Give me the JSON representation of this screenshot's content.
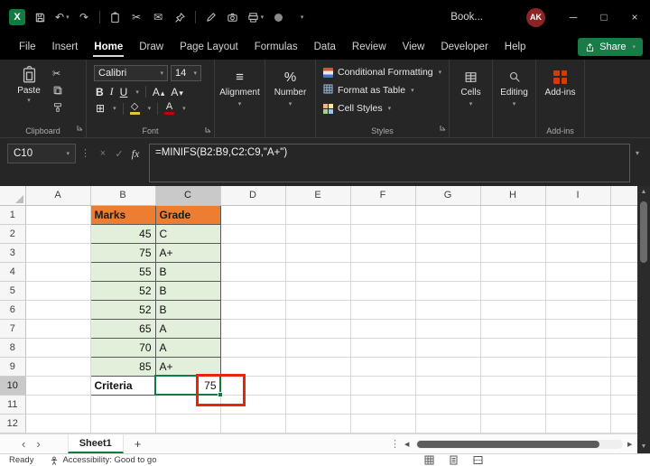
{
  "title_bar": {
    "document_title": "Book...",
    "avatar_initials": "AK"
  },
  "menu": {
    "tabs": [
      "File",
      "Insert",
      "Home",
      "Draw",
      "Page Layout",
      "Formulas",
      "Data",
      "Review",
      "View",
      "Developer",
      "Help"
    ],
    "active_tab": "Home",
    "share_label": "Share"
  },
  "ribbon": {
    "clipboard": {
      "paste_label": "Paste",
      "group_label": "Clipboard"
    },
    "font": {
      "name": "Calibri",
      "size": "14",
      "bold": "B",
      "italic": "I",
      "underline": "U",
      "grow": "A",
      "shrink": "A",
      "color_letter": "A",
      "group_label": "Font"
    },
    "alignment": {
      "label": "Alignment"
    },
    "number": {
      "label": "Number"
    },
    "styles": {
      "conditional_formatting": "Conditional Formatting",
      "format_as_table": "Format as Table",
      "cell_styles": "Cell Styles",
      "group_label": "Styles"
    },
    "cells": {
      "label": "Cells"
    },
    "editing": {
      "label": "Editing"
    },
    "addins": {
      "label": "Add-ins",
      "group_label": "Add-ins"
    }
  },
  "formula_bar": {
    "name_box": "C10",
    "fx_label": "fx",
    "formula": "=MINIFS(B2:B9,C2:C9,\"A+\")"
  },
  "sheet": {
    "columns": [
      "A",
      "B",
      "C",
      "D",
      "E",
      "F",
      "G",
      "H",
      "I"
    ],
    "num_rows": 12,
    "selected": {
      "col": "C",
      "row": 10
    },
    "cells": [
      {
        "r": 1,
        "c": "B",
        "v": "Marks",
        "s": "orange"
      },
      {
        "r": 1,
        "c": "C",
        "v": "Grade",
        "s": "orange"
      },
      {
        "r": 2,
        "c": "B",
        "v": "45",
        "s": "num"
      },
      {
        "r": 2,
        "c": "C",
        "v": "C",
        "s": "txt"
      },
      {
        "r": 3,
        "c": "B",
        "v": "75",
        "s": "num"
      },
      {
        "r": 3,
        "c": "C",
        "v": "A+",
        "s": "txt"
      },
      {
        "r": 4,
        "c": "B",
        "v": "55",
        "s": "num"
      },
      {
        "r": 4,
        "c": "C",
        "v": "B",
        "s": "txt"
      },
      {
        "r": 5,
        "c": "B",
        "v": "52",
        "s": "num"
      },
      {
        "r": 5,
        "c": "C",
        "v": "B",
        "s": "txt"
      },
      {
        "r": 6,
        "c": "B",
        "v": "52",
        "s": "num"
      },
      {
        "r": 6,
        "c": "C",
        "v": "B",
        "s": "txt"
      },
      {
        "r": 7,
        "c": "B",
        "v": "65",
        "s": "num"
      },
      {
        "r": 7,
        "c": "C",
        "v": "A",
        "s": "txt"
      },
      {
        "r": 8,
        "c": "B",
        "v": "70",
        "s": "num"
      },
      {
        "r": 8,
        "c": "C",
        "v": "A",
        "s": "txt"
      },
      {
        "r": 9,
        "c": "B",
        "v": "85",
        "s": "num"
      },
      {
        "r": 9,
        "c": "C",
        "v": "A+",
        "s": "txt"
      },
      {
        "r": 10,
        "c": "B",
        "v": "Criteria",
        "s": "label"
      },
      {
        "r": 10,
        "c": "C",
        "v": "75",
        "s": "result"
      }
    ]
  },
  "sheet_tabs": {
    "active_sheet": "Sheet1"
  },
  "status_bar": {
    "ready": "Ready",
    "accessibility": "Accessibility: Good to go"
  },
  "icons": {
    "undo": "↶",
    "redo": "↷",
    "cut": "✂",
    "mail": "✉",
    "minimize": "─",
    "maximize": "□",
    "close": "×",
    "prev_sheet": "‹",
    "next_sheet": "›",
    "add_sheet": "+",
    "align": "≡",
    "percent": "%",
    "borders": "⊞",
    "fill_diamond": "◇",
    "cancel": "×",
    "enter": "✓",
    "dots": "⋮",
    "scroll_up": "▲",
    "scroll_down": "▼",
    "scroll_left": "◀",
    "scroll_right": "▶",
    "chevron": "▾"
  },
  "colors": {
    "accent_green": "#107C41",
    "orange_fill": "#ED7D31",
    "green_fill": "#E2EFDA",
    "annotation_red": "#E8240C",
    "avatar_red": "#8E2323"
  }
}
